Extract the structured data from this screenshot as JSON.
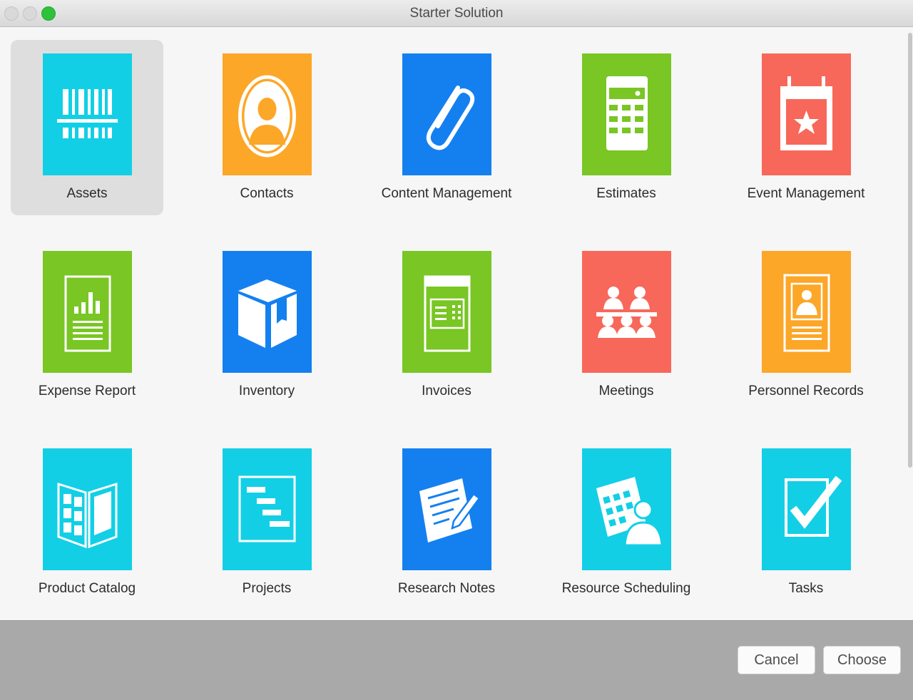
{
  "window": {
    "title": "Starter Solution"
  },
  "templates": [
    {
      "label": "Assets",
      "icon": "barcode-icon",
      "color": "#12cfe6",
      "selected": true
    },
    {
      "label": "Contacts",
      "icon": "person-icon",
      "color": "#fca728"
    },
    {
      "label": "Content Management",
      "icon": "paperclip-icon",
      "color": "#1480f0"
    },
    {
      "label": "Estimates",
      "icon": "calculator-icon",
      "color": "#79c624"
    },
    {
      "label": "Event Management",
      "icon": "calendar-star-icon",
      "color": "#f7685a"
    },
    {
      "label": "Expense Report",
      "icon": "report-chart-icon",
      "color": "#79c624"
    },
    {
      "label": "Inventory",
      "icon": "box-icon",
      "color": "#1480f0"
    },
    {
      "label": "Invoices",
      "icon": "invoice-icon",
      "color": "#79c624"
    },
    {
      "label": "Meetings",
      "icon": "meeting-people-icon",
      "color": "#f7685a"
    },
    {
      "label": "Personnel Records",
      "icon": "personnel-card-icon",
      "color": "#fca728"
    },
    {
      "label": "Product Catalog",
      "icon": "open-catalog-icon",
      "color": "#12cfe6"
    },
    {
      "label": "Projects",
      "icon": "gantt-chart-icon",
      "color": "#12cfe6"
    },
    {
      "label": "Research Notes",
      "icon": "notepad-pencil-icon",
      "color": "#1480f0"
    },
    {
      "label": "Resource Scheduling",
      "icon": "calendar-person-icon",
      "color": "#12cfe6"
    },
    {
      "label": "Tasks",
      "icon": "checkbox-icon",
      "color": "#12cfe6"
    }
  ],
  "footer": {
    "cancel_label": "Cancel",
    "choose_label": "Choose"
  }
}
